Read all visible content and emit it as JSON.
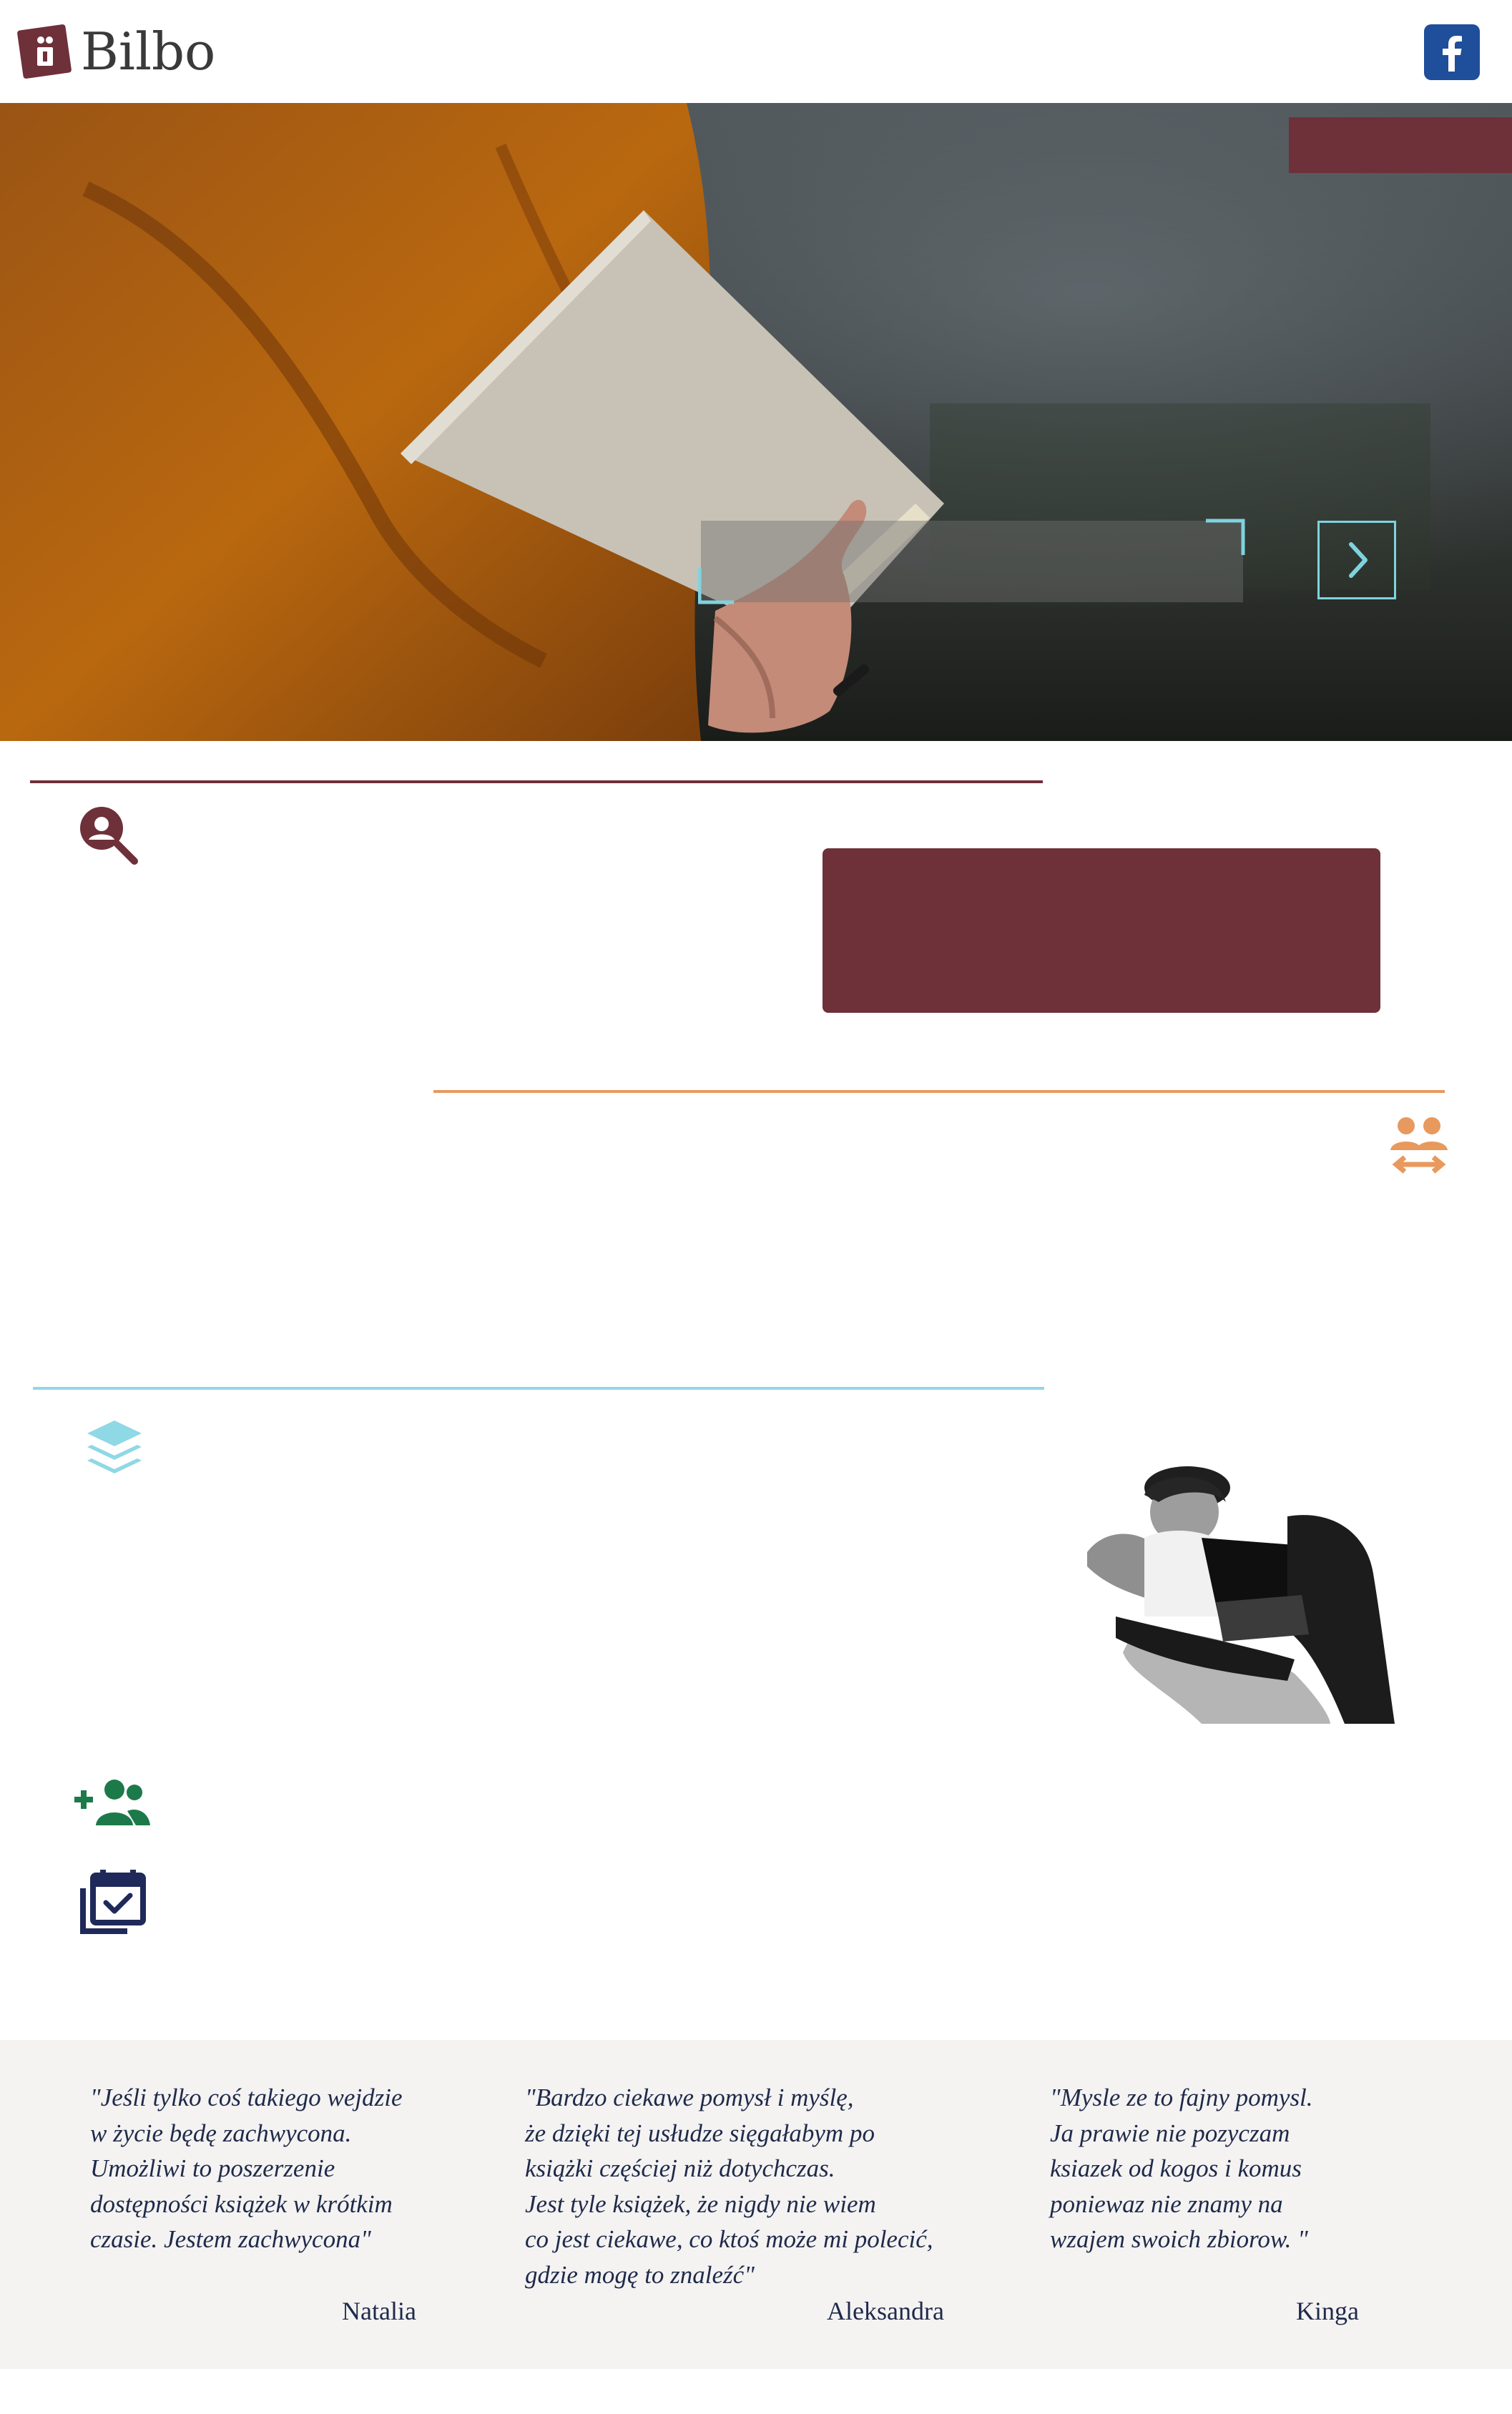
{
  "header": {
    "logo_text": "Bilbo",
    "logo_icon": "bilbo-logo-icon",
    "social_icon": "facebook-icon"
  },
  "hero": {
    "next_icon": "chevron-right-icon"
  },
  "sections": [
    {
      "icon": "search-user-icon",
      "color": "#6e3039"
    },
    {
      "icon": "users-exchange-icon",
      "color": "#e8995e"
    },
    {
      "icon": "layers-icon",
      "color": "#8fd8e5"
    },
    {
      "icon": "user-plus-group-icon",
      "color": "#1c7a4a"
    },
    {
      "icon": "calendar-check-icon",
      "color": "#1f2a5a"
    }
  ],
  "colors": {
    "brand": "#6e3039",
    "accent_orange": "#e8995e",
    "accent_cyan": "#8fd8e5",
    "text_navy": "#1f2a4a"
  },
  "testimonials": [
    {
      "quote": "\"Jeśli tylko coś takiego wejdzie\nw życie będę zachwycona.\nUmożliwi to poszerzenie\ndostępności książek w krótkim\nczasie. Jestem zachwycona\"",
      "author": "Natalia"
    },
    {
      "quote": "\"Bardzo ciekawe pomysł i myślę,\nże dzięki tej usłudze sięgałabym po\nksiążki częściej niż dotychczas.\nJest tyle książek, że nigdy nie wiem\nco jest ciekawe, co ktoś może mi polecić,\ngdzie mogę to znaleźć\"",
      "author": "Aleksandra"
    },
    {
      "quote": "\"Mysle ze to fajny pomysl.\nJa prawie nie pozyczam\nksiazek od kogos i komus\nponiewaz nie znamy na\nwzajem swoich zbiorow. \"",
      "author": "Kinga"
    }
  ]
}
